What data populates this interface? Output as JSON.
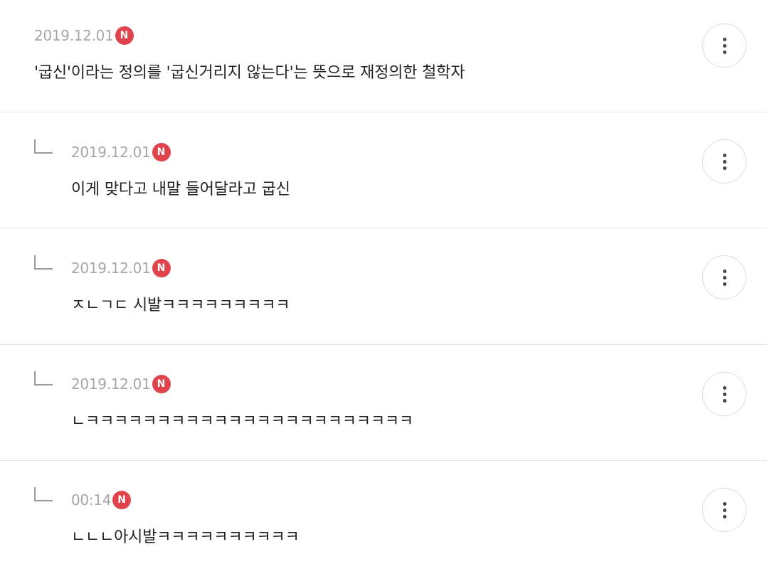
{
  "comments": [
    {
      "date": "2019.12.01",
      "badge": "N",
      "text": "'굽신'이라는 정의를 '굽신거리지 않는다'는 뜻으로 재정의한 철학자",
      "more_icon": "more-vertical-icon"
    },
    {
      "date": "2019.12.01",
      "badge": "N",
      "text": "이게 맞다고 내말 들어달라고 굽신",
      "reply_icon": "reply-arrow-icon",
      "more_icon": "more-vertical-icon"
    },
    {
      "date": "2019.12.01",
      "badge": "N",
      "text": "ㅈㄴㄱㄷ 시발ㅋㅋㅋㅋㅋㅋㅋㅋㅋ",
      "reply_icon": "reply-arrow-icon",
      "more_icon": "more-vertical-icon"
    },
    {
      "date": "2019.12.01",
      "badge": "N",
      "text": "ㄴㅋㅋㅋㅋㅋㅋㅋㅋㅋㅋㅋㅋㅋㅋㅋㅋㅋㅋㅋㅋㅋㅋㅋ",
      "reply_icon": "reply-arrow-icon",
      "more_icon": "more-vertical-icon"
    },
    {
      "date": "00:14",
      "badge": "N",
      "text": "ㄴㄴㄴ아시발ㅋㅋㅋㅋㅋㅋㅋㅋㅋㅋ",
      "reply_icon": "reply-arrow-icon",
      "more_icon": "more-vertical-icon"
    }
  ],
  "colors": {
    "badge": "#e0434b",
    "date": "#a6a6a6",
    "text": "#222222",
    "divider": "#e6e6e6"
  }
}
